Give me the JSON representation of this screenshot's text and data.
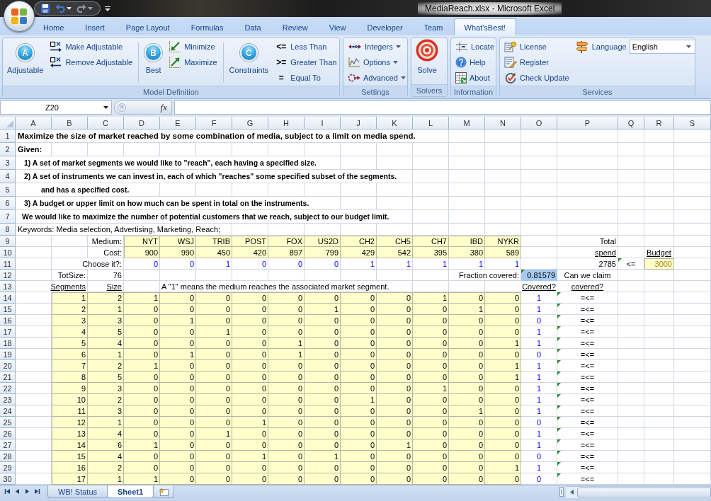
{
  "window": {
    "title": "MediaReach.xlsx - Microsoft Excel"
  },
  "ribbon_tabs": [
    {
      "label": "Home",
      "selected": false
    },
    {
      "label": "Insert",
      "selected": false
    },
    {
      "label": "Page Layout",
      "selected": false
    },
    {
      "label": "Formulas",
      "selected": false
    },
    {
      "label": "Data",
      "selected": false
    },
    {
      "label": "Review",
      "selected": false
    },
    {
      "label": "View",
      "selected": false
    },
    {
      "label": "Developer",
      "selected": false
    },
    {
      "label": "Team",
      "selected": false
    },
    {
      "label": "What'sBest!",
      "selected": true
    }
  ],
  "ribbon_groups": [
    {
      "label": "Model Definition",
      "items": [
        {
          "kind": "letter",
          "badge": "A",
          "label": "Adjustable"
        },
        {
          "kind": "stack",
          "buttons": [
            {
              "label": "Make Adjustable",
              "dropdown": false
            },
            {
              "label": "Remove Adjustable",
              "dropdown": false
            }
          ]
        },
        {
          "kind": "letter",
          "badge": "B",
          "label": "Best"
        },
        {
          "kind": "stack",
          "buttons": [
            {
              "label": "Minimize",
              "dropdown": false
            },
            {
              "label": "Maximize",
              "dropdown": false
            }
          ]
        },
        {
          "kind": "letter",
          "badge": "C",
          "label": "Constraints"
        },
        {
          "kind": "stack",
          "buttons": [
            {
              "label": "Less Than",
              "glyph": "<=",
              "dropdown": false
            },
            {
              "label": "Greater Than",
              "glyph": ">=",
              "dropdown": false
            },
            {
              "label": "Equal To",
              "glyph": "=",
              "dropdown": false
            }
          ]
        }
      ]
    },
    {
      "label": "Settings",
      "items": [
        {
          "kind": "stack",
          "buttons": [
            {
              "label": "Integers",
              "dropdown": true
            },
            {
              "label": "Options",
              "dropdown": true
            },
            {
              "label": "Advanced",
              "dropdown": true
            }
          ]
        }
      ]
    },
    {
      "label": "Solvers",
      "items": [
        {
          "kind": "large",
          "label": "Solve"
        }
      ]
    },
    {
      "label": "Information",
      "items": [
        {
          "kind": "stack",
          "buttons": [
            {
              "label": "Locate",
              "dropdown": false
            },
            {
              "label": "Help",
              "dropdown": false
            },
            {
              "label": "About",
              "dropdown": false
            }
          ]
        }
      ]
    },
    {
      "label": "Services",
      "items": [
        {
          "kind": "stack",
          "buttons": [
            {
              "label": "License",
              "dropdown": false
            },
            {
              "label": "Register",
              "dropdown": false
            },
            {
              "label": "Check Update",
              "dropdown": false
            }
          ]
        },
        {
          "kind": "combo",
          "label": "Language",
          "value": "English"
        }
      ]
    }
  ],
  "formula_bar": {
    "name_box": "Z20",
    "function_label": "fx"
  },
  "sheet": {
    "column_headers": [
      "A",
      "B",
      "C",
      "D",
      "E",
      "F",
      "G",
      "H",
      "I",
      "J",
      "K",
      "L",
      "M",
      "N",
      "O",
      "P",
      "Q",
      "R",
      "S"
    ],
    "row_headers": [
      "1",
      "2",
      "3",
      "4",
      "5",
      "6",
      "7",
      "8",
      "9",
      "10",
      "11",
      "12",
      "13",
      "14",
      "15",
      "16",
      "17",
      "18",
      "19",
      "20",
      "21",
      "22",
      "23",
      "24",
      "25",
      "26",
      "27",
      "28",
      "29",
      "30"
    ],
    "lines": [
      {
        "kind": "title",
        "text": "Maximize the size of market reached by some combination of media, subject to a limit on media spend."
      },
      {
        "kind": "heading",
        "text": "Given:"
      },
      {
        "kind": "point",
        "text": "1) A set of market segments we would like to \"reach\", each having a specified size."
      },
      {
        "kind": "point",
        "text": "2) A set of instruments we can invest in, each of which \"reaches\" some specified subset of the segments."
      },
      {
        "kind": "continuation",
        "text": "and has a specified cost."
      },
      {
        "kind": "point",
        "text": "3) A budget or upper limit on how much can be spent in total on the instruments."
      },
      {
        "kind": "conclusion",
        "text": "We would like to maximize the number of potential customers that we reach, subject to our budget limit."
      },
      {
        "kind": "keywords",
        "text": "Keywords: Media selection, Advertising, Marketing, Reach;"
      }
    ],
    "medium_label": "Medium:",
    "cost_label": "Cost:",
    "choose_label": "Choose it?:",
    "media": [
      {
        "name": "NYT",
        "cost": "900",
        "choose": "0"
      },
      {
        "name": "WSJ",
        "cost": "990",
        "choose": "0"
      },
      {
        "name": "TRIB",
        "cost": "450",
        "choose": "1"
      },
      {
        "name": "POST",
        "cost": "420",
        "choose": "0"
      },
      {
        "name": "FOX",
        "cost": "897",
        "choose": "0"
      },
      {
        "name": "US2D",
        "cost": "799",
        "choose": "0"
      },
      {
        "name": "CH2",
        "cost": "429",
        "choose": "1"
      },
      {
        "name": "CH5",
        "cost": "542",
        "choose": "1"
      },
      {
        "name": "CH7",
        "cost": "395",
        "choose": "1"
      },
      {
        "name": "IBD",
        "cost": "380",
        "choose": "1"
      },
      {
        "name": "NYKR",
        "cost": "589",
        "choose": "1"
      }
    ],
    "total_spend": {
      "label": "Total",
      "sublabel": "spend",
      "value": "2785"
    },
    "relation": {
      "text": "<=",
      "flagged": true
    },
    "budget": {
      "label": "Budget",
      "value": "3000"
    },
    "tot_size": {
      "label": "TotSize:",
      "value": "76"
    },
    "fraction": {
      "label": "Fraction covered:",
      "value": "0.81579",
      "flagged": true
    },
    "claim": {
      "label": "Can we claim",
      "sublabel": "covered?"
    },
    "segment_columns": {
      "segments": "Segments",
      "size": "Size",
      "covered": "Covered?"
    },
    "note": "A \"1\" means the medium reaches the associated market segment.",
    "segments": [
      {
        "id": "1",
        "size": "2",
        "reach": [
          "1",
          "0",
          "0",
          "0",
          "0",
          "0",
          "0",
          "0",
          "1",
          "0",
          "0"
        ],
        "covered": "1",
        "constraint": "=<=",
        "flagged": true
      },
      {
        "id": "2",
        "size": "1",
        "reach": [
          "0",
          "0",
          "0",
          "0",
          "0",
          "1",
          "0",
          "0",
          "0",
          "1",
          "0"
        ],
        "covered": "1",
        "constraint": "=<=",
        "flagged": true
      },
      {
        "id": "3",
        "size": "3",
        "reach": [
          "0",
          "1",
          "0",
          "0",
          "0",
          "0",
          "0",
          "0",
          "0",
          "0",
          "0"
        ],
        "covered": "0",
        "constraint": "=<=",
        "flagged": true
      },
      {
        "id": "4",
        "size": "5",
        "reach": [
          "0",
          "0",
          "1",
          "0",
          "0",
          "0",
          "0",
          "0",
          "0",
          "0",
          "0"
        ],
        "covered": "1",
        "constraint": "=<=",
        "flagged": true
      },
      {
        "id": "5",
        "size": "4",
        "reach": [
          "0",
          "0",
          "0",
          "0",
          "1",
          "0",
          "0",
          "0",
          "0",
          "0",
          "1"
        ],
        "covered": "1",
        "constraint": "=<=",
        "flagged": true
      },
      {
        "id": "6",
        "size": "1",
        "reach": [
          "0",
          "1",
          "0",
          "0",
          "1",
          "0",
          "0",
          "0",
          "0",
          "0",
          "0"
        ],
        "covered": "0",
        "constraint": "=<=",
        "flagged": true
      },
      {
        "id": "7",
        "size": "2",
        "reach": [
          "1",
          "0",
          "0",
          "0",
          "0",
          "0",
          "0",
          "0",
          "0",
          "0",
          "1"
        ],
        "covered": "1",
        "constraint": "=<=",
        "flagged": true
      },
      {
        "id": "8",
        "size": "5",
        "reach": [
          "0",
          "0",
          "0",
          "0",
          "0",
          "0",
          "0",
          "0",
          "0",
          "0",
          "1"
        ],
        "covered": "1",
        "constraint": "=<=",
        "flagged": true
      },
      {
        "id": "9",
        "size": "3",
        "reach": [
          "0",
          "0",
          "0",
          "0",
          "0",
          "0",
          "0",
          "0",
          "1",
          "0",
          "0"
        ],
        "covered": "1",
        "constraint": "=<=",
        "flagged": true
      },
      {
        "id": "10",
        "size": "2",
        "reach": [
          "0",
          "0",
          "0",
          "0",
          "0",
          "0",
          "1",
          "0",
          "0",
          "0",
          "0"
        ],
        "covered": "1",
        "constraint": "=<=",
        "flagged": true
      },
      {
        "id": "11",
        "size": "3",
        "reach": [
          "0",
          "0",
          "0",
          "0",
          "0",
          "0",
          "0",
          "0",
          "0",
          "1",
          "0"
        ],
        "covered": "1",
        "constraint": "=<=",
        "flagged": true
      },
      {
        "id": "12",
        "size": "1",
        "reach": [
          "0",
          "0",
          "0",
          "1",
          "0",
          "0",
          "0",
          "0",
          "0",
          "0",
          "0"
        ],
        "covered": "0",
        "constraint": "=<=",
        "flagged": true
      },
      {
        "id": "13",
        "size": "4",
        "reach": [
          "0",
          "0",
          "1",
          "0",
          "0",
          "0",
          "0",
          "0",
          "0",
          "0",
          "0"
        ],
        "covered": "1",
        "constraint": "=<=",
        "flagged": true
      },
      {
        "id": "14",
        "size": "6",
        "reach": [
          "1",
          "0",
          "0",
          "0",
          "0",
          "0",
          "0",
          "1",
          "0",
          "0",
          "0"
        ],
        "covered": "1",
        "constraint": "=<=",
        "flagged": true
      },
      {
        "id": "15",
        "size": "4",
        "reach": [
          "0",
          "0",
          "0",
          "1",
          "0",
          "1",
          "0",
          "0",
          "0",
          "0",
          "0"
        ],
        "covered": "0",
        "constraint": "=<=",
        "flagged": true
      },
      {
        "id": "16",
        "size": "2",
        "reach": [
          "0",
          "0",
          "0",
          "0",
          "0",
          "0",
          "0",
          "0",
          "0",
          "0",
          "1"
        ],
        "covered": "1",
        "constraint": "=<=",
        "flagged": true
      },
      {
        "id": "17",
        "size": "1",
        "reach": [
          "1",
          "0",
          "0",
          "0",
          "0",
          "0",
          "0",
          "0",
          "0",
          "0",
          "0"
        ],
        "covered": "0",
        "constraint": "=<=",
        "flagged": true
      }
    ]
  },
  "sheet_tabs": [
    {
      "label": "WB! Status",
      "selected": false
    },
    {
      "label": "Sheet1",
      "selected": true
    }
  ]
}
